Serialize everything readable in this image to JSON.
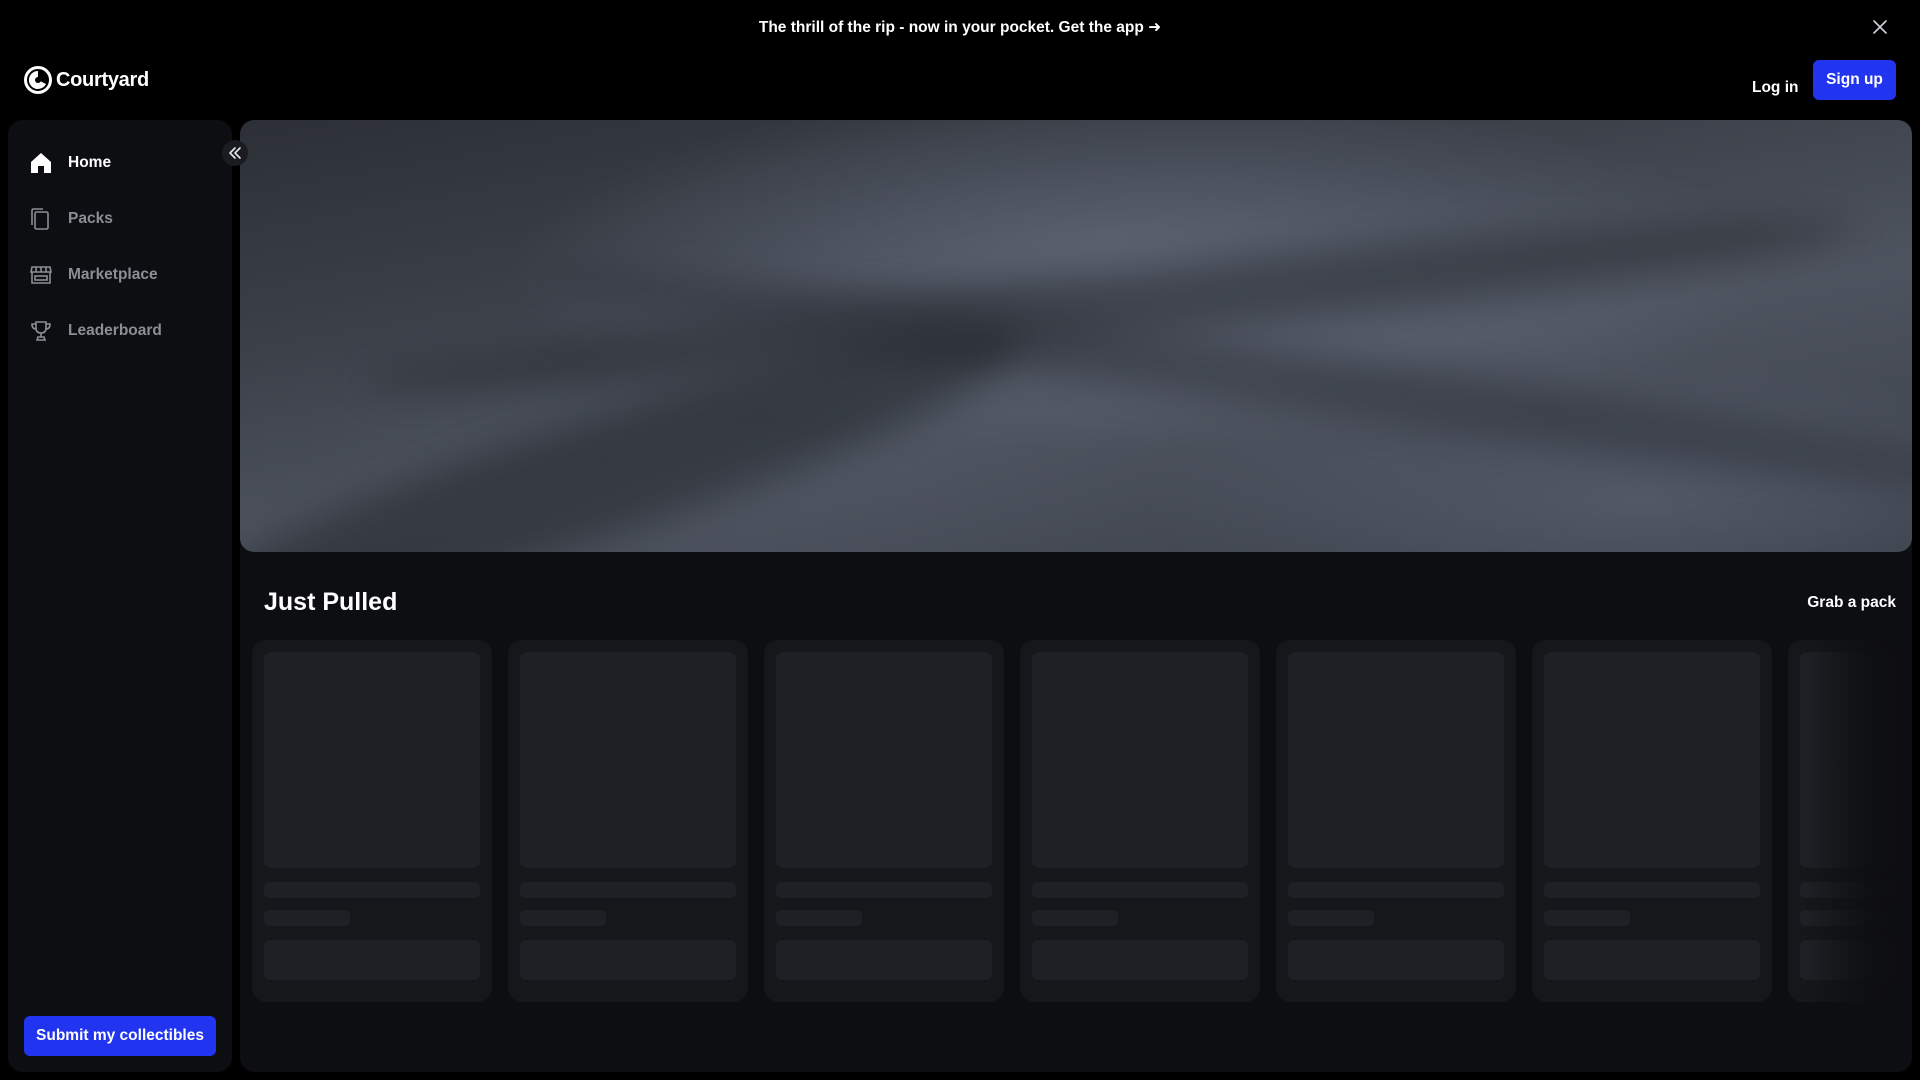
{
  "banner": {
    "text": "The thrill of the rip - now in your pocket. Get the app ➜",
    "close_icon": "close-icon"
  },
  "header": {
    "logo_text": "Courtyard",
    "login_label": "Log in",
    "signup_label": "Sign up"
  },
  "sidebar": {
    "items": [
      {
        "label": "Home",
        "icon": "home-icon",
        "active": true
      },
      {
        "label": "Packs",
        "icon": "packs-icon",
        "active": false
      },
      {
        "label": "Marketplace",
        "icon": "storefront-icon",
        "active": false
      },
      {
        "label": "Leaderboard",
        "icon": "trophy-icon",
        "active": false
      }
    ],
    "collapse_icon": "chevrons-left-icon",
    "submit_label": "Submit my collectibles"
  },
  "main": {
    "section_title": "Just Pulled",
    "grab_link": "Grab a pack"
  },
  "colors": {
    "accent": "#2134ef",
    "background": "#000000",
    "panel": "#0d0e11",
    "card": "#16171b",
    "skeleton": "#1f2025"
  }
}
